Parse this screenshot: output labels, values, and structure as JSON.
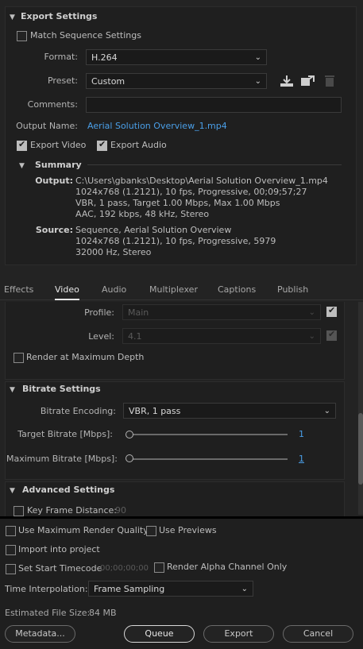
{
  "export": {
    "header": "Export Settings",
    "match_sequence": "Match Sequence Settings",
    "format_label": "Format:",
    "format_value": "H.264",
    "preset_label": "Preset:",
    "preset_value": "Custom",
    "comments_label": "Comments:",
    "comments_value": "",
    "output_name_label": "Output Name:",
    "output_name_value": "Aerial Solution Overview_1.mp4",
    "export_video": "Export Video",
    "export_audio": "Export Audio"
  },
  "summary": {
    "header": "Summary",
    "output_label": "Output:",
    "output_lines": [
      "C:\\Users\\gbanks\\Desktop\\Aerial Solution Overview_1.mp4",
      "1024x768 (1.2121), 10 fps, Progressive, 00;09;57;27",
      "VBR, 1 pass, Target 1.00 Mbps, Max 1.00 Mbps",
      "AAC, 192 kbps, 48 kHz, Stereo"
    ],
    "source_label": "Source:",
    "source_lines": [
      "Sequence, Aerial Solution Overview",
      "1024x768 (1.2121), 10 fps, Progressive, 5979",
      "32000 Hz, Stereo"
    ]
  },
  "tabs": [
    "Effects",
    "Video",
    "Audio",
    "Multiplexer",
    "Captions",
    "Publish"
  ],
  "video": {
    "profile_label": "Profile:",
    "profile_value": "Main",
    "level_label": "Level:",
    "level_value": "4.1",
    "render_max_depth": "Render at Maximum Depth"
  },
  "bitrate": {
    "header": "Bitrate Settings",
    "encoding_label": "Bitrate Encoding:",
    "encoding_value": "VBR, 1 pass",
    "target_label": "Target Bitrate [Mbps]:",
    "target_value": "1",
    "max_label": "Maximum Bitrate [Mbps]:",
    "max_value": "1"
  },
  "advanced": {
    "header": "Advanced Settings",
    "key_frame_label": "Key Frame Distance:",
    "key_frame_value": "90"
  },
  "bottom": {
    "use_max_render": "Use Maximum Render Quality",
    "use_previews": "Use Previews",
    "import_project": "Import into project",
    "set_start_timecode": "Set Start Timecode",
    "timecode_value": "00;00;00;00",
    "render_alpha": "Render Alpha Channel Only",
    "time_interp_label": "Time Interpolation:",
    "time_interp_value": "Frame Sampling",
    "est_size_label": "Estimated File Size:",
    "est_size_value": "84 MB"
  },
  "buttons": {
    "metadata": "Metadata...",
    "queue": "Queue",
    "export": "Export",
    "cancel": "Cancel"
  },
  "colors": {
    "background": "#232323",
    "link": "#4a9fe8",
    "text": "#bdbdbd"
  }
}
